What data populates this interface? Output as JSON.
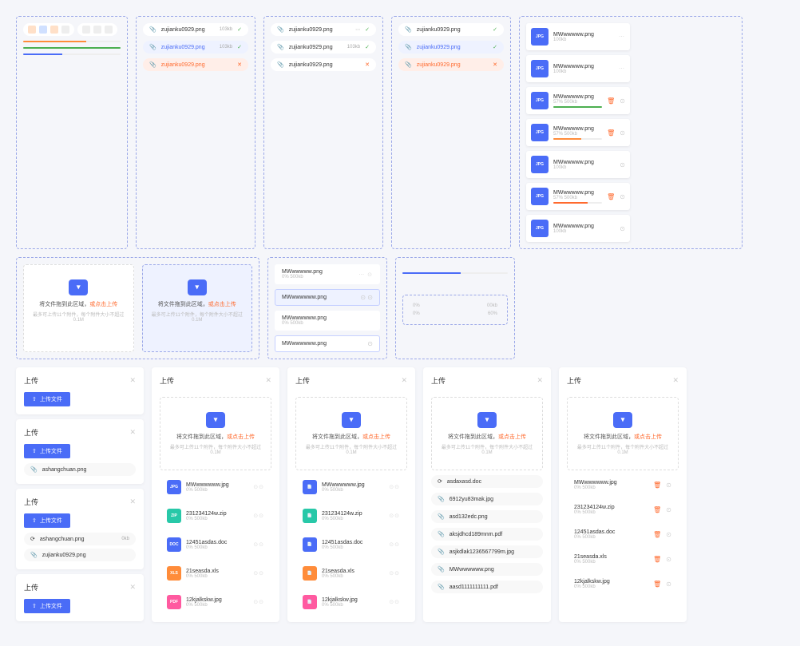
{
  "pills": {
    "f1": "zujianku0929.png",
    "f2": "zujianku0929.png",
    "s1": "103kb",
    "s2": "103kb"
  },
  "drop": {
    "txt": "将文件拖到此区域，",
    "lk": "或点击上传",
    "sub": "最多可上传11个附件，每个附件大小不超过0.1M"
  },
  "files": {
    "n1": "MWwwwww.png",
    "n2": "MWwwwwww.png",
    "sub": "0%  500kb"
  },
  "upload": {
    "title": "上传",
    "btn": "上传文件"
  },
  "list": {
    "f1": "ashangchuan.png",
    "f2": "zujianku0929.png",
    "f3": "asdaxasd.doc",
    "f4": "6912yu83mak.jpg",
    "f5": "asd132edc.png",
    "f6": "aksjdhcd189mnm.pdf",
    "f7": "asjkdlak1236567799m.jpg",
    "f8": "aasd1111111111.pdf",
    "sz": "0kb"
  },
  "types": {
    "t1": "MWwwwwww.jpg",
    "t2": "231234124w.zip",
    "t3": "12451asdas.doc",
    "t4": "21seasda.xls",
    "t5": "12kjalkskw.jpg",
    "sub": "0%  500kb"
  },
  "thumb": {
    "n": "MWwwwww.png",
    "sub": "100kb",
    "sub2": "57%  500kb"
  },
  "sm": {
    "a": "0%",
    "b": "00kb",
    "c": "60%"
  },
  "colors": {
    "orange": "#ff8c3a",
    "green": "#4caf50",
    "blue": "#4a6cf7",
    "red": "#ff6a2e"
  }
}
